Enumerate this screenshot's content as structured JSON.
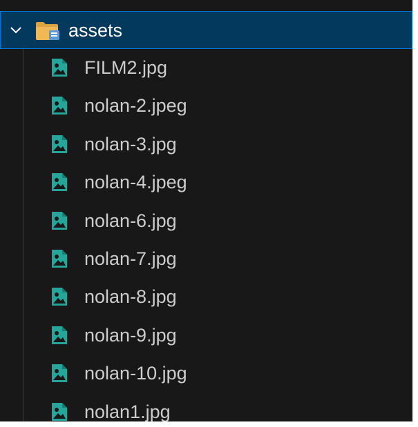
{
  "explorer": {
    "folder": {
      "name": "assets",
      "expanded": true,
      "icon": "folder-open-icon",
      "chevron_icon": "chevron-down-icon"
    },
    "files": [
      {
        "name": "FILM2.jpg",
        "icon": "image-file-icon"
      },
      {
        "name": "nolan-2.jpeg",
        "icon": "image-file-icon"
      },
      {
        "name": "nolan-3.jpg",
        "icon": "image-file-icon"
      },
      {
        "name": "nolan-4.jpeg",
        "icon": "image-file-icon"
      },
      {
        "name": "nolan-6.jpg",
        "icon": "image-file-icon"
      },
      {
        "name": "nolan-7.jpg",
        "icon": "image-file-icon"
      },
      {
        "name": "nolan-8.jpg",
        "icon": "image-file-icon"
      },
      {
        "name": "nolan-9.jpg",
        "icon": "image-file-icon"
      },
      {
        "name": "nolan-10.jpg",
        "icon": "image-file-icon"
      },
      {
        "name": "nolan1.jpg",
        "icon": "image-file-icon"
      }
    ],
    "colors": {
      "background": "#181818",
      "selected_background": "#04395e",
      "selected_border": "#0078d4",
      "file_text": "#cccccc",
      "folder_text": "#ffffff",
      "image_icon": "#26a69a",
      "folder_icon": "#f0b955"
    }
  }
}
